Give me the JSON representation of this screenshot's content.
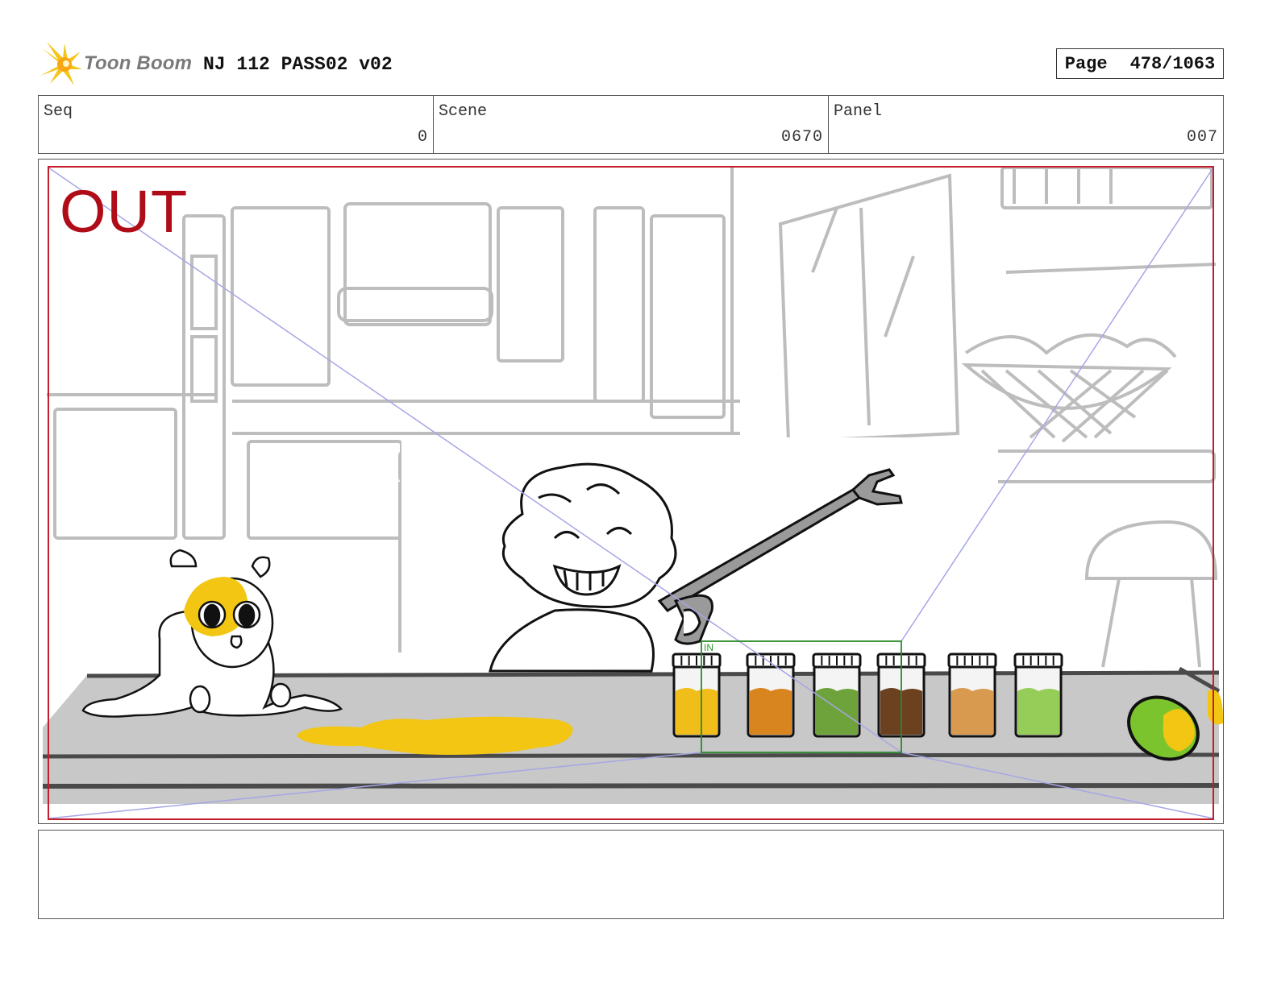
{
  "header": {
    "logo_text": "Toon Boom",
    "logo_icon": "starburst-icon",
    "project_title": "NJ 112 PASS02 v02",
    "page_label": "Page",
    "page_number": "478/1063"
  },
  "info": {
    "seq_label": "Seq",
    "seq_value": "0",
    "scene_label": "Scene",
    "scene_value": "0670",
    "panel_label": "Panel",
    "panel_value": "007"
  },
  "panel": {
    "out_label": "OUT",
    "in_label": "IN",
    "colors": {
      "out_frame": "#c41e2a",
      "in_frame": "#2a8a2a",
      "camera_lines": "#a6a6e6",
      "counter": "#c8c8c8",
      "spill": "#f2c613"
    },
    "jars": [
      {
        "fill": "#f0bd1a"
      },
      {
        "fill": "#d9851f"
      },
      {
        "fill": "#6da33a"
      },
      {
        "fill": "#6b4120"
      },
      {
        "fill": "#d79a4e"
      },
      {
        "fill": "#96cc58"
      }
    ]
  },
  "notes": {
    "text": ""
  }
}
